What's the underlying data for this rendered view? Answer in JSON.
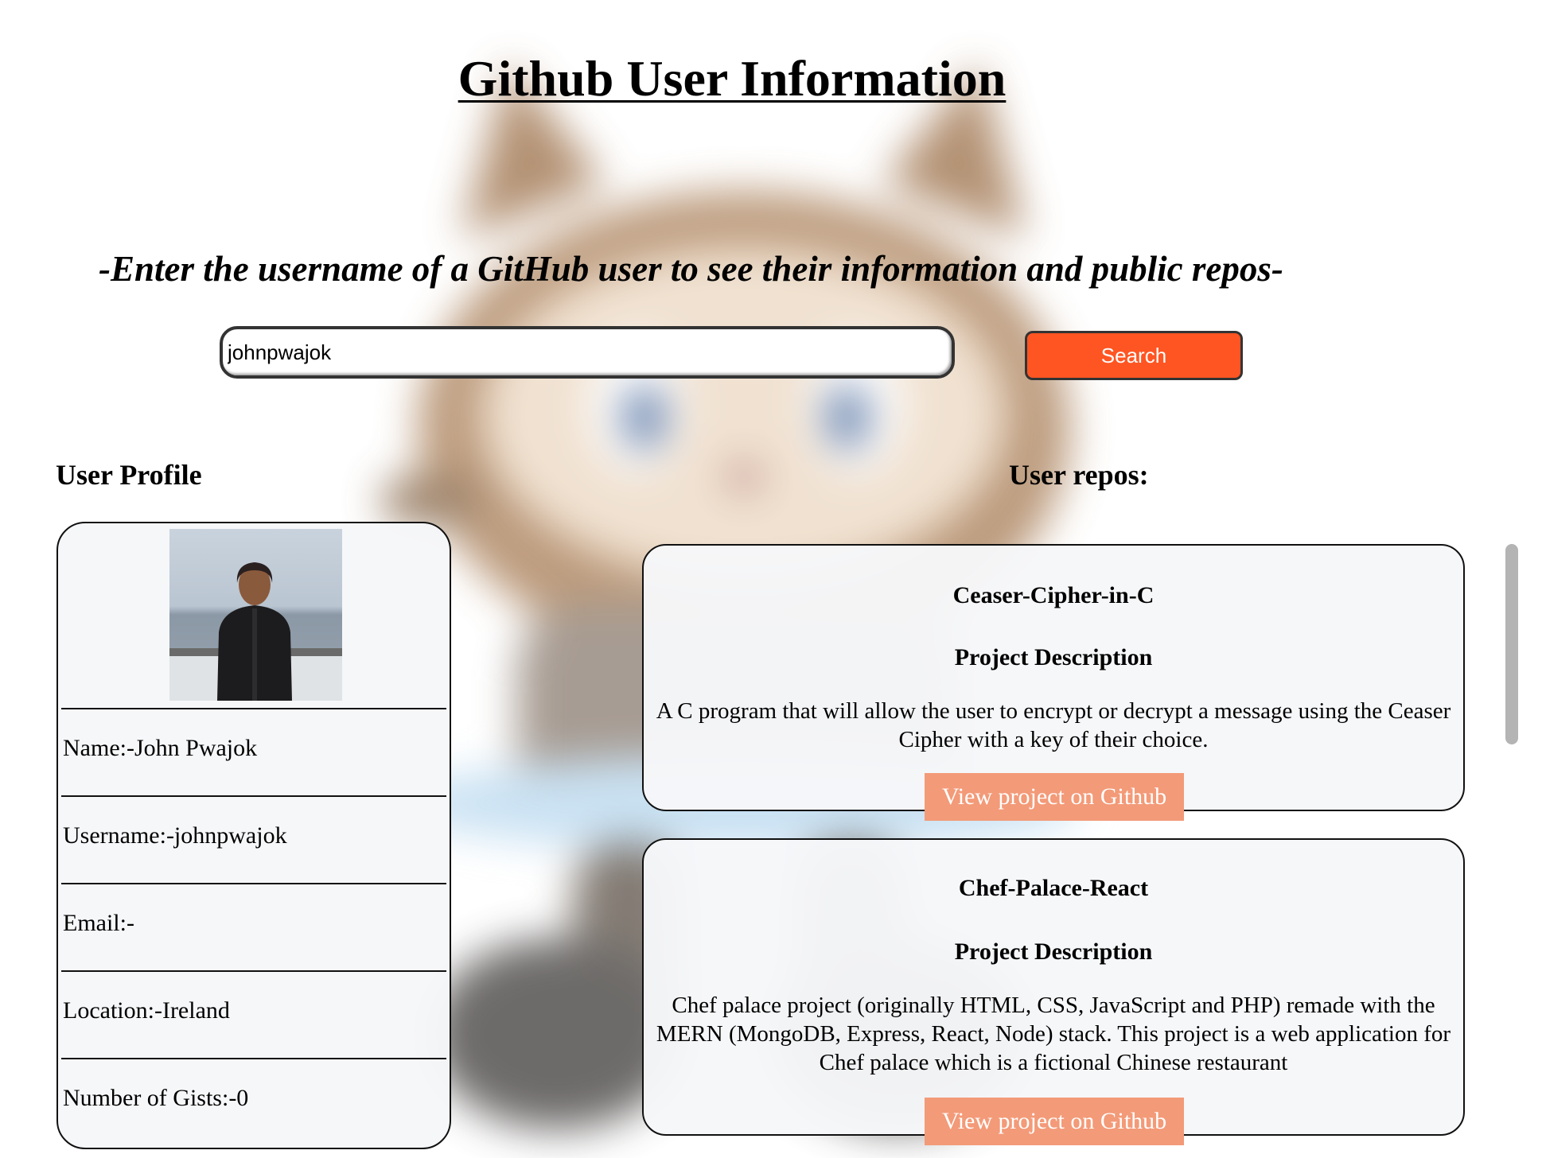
{
  "header": {
    "title": "Github User Information",
    "subtitle": "-Enter the username of a GitHub user to see their information and public repos-"
  },
  "search": {
    "value": "johnpwajok",
    "button_label": "Search"
  },
  "profile": {
    "heading": "User Profile",
    "name": "Name:-John Pwajok",
    "username": "Username:-johnpwajok",
    "email": "Email:-",
    "location": "Location:-Ireland",
    "gists": "Number of Gists:-0"
  },
  "repos": {
    "heading": "User repos:",
    "items": [
      {
        "name": "Ceaser-Cipher-in-C",
        "desc_heading": "Project Description",
        "description": "A C program that will allow the user to encrypt or decrypt a message using the Ceaser Cipher with a key of their choice.",
        "link_label": "View project on Github"
      },
      {
        "name": "Chef-Palace-React",
        "desc_heading": "Project Description",
        "description": "Chef palace project (originally HTML, CSS, JavaScript and PHP) remade with the MERN (MongoDB, Express, React, Node) stack. This project is a web application for Chef palace which is a fictional Chinese restaurant",
        "link_label": "View project on Github"
      }
    ]
  },
  "colors": {
    "search_button": "#ff5522",
    "repo_link": "#f39a78",
    "card_background": "#f6f7f9"
  }
}
